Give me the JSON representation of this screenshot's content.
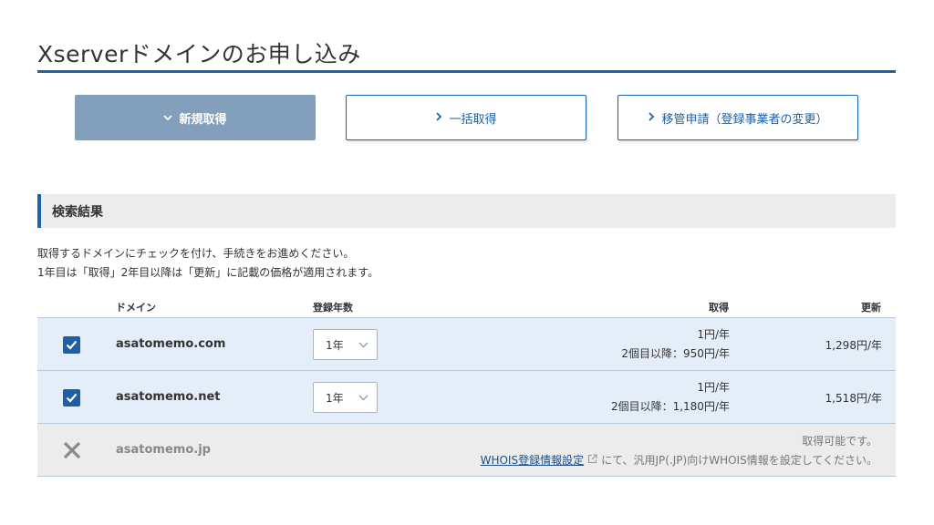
{
  "page": {
    "title": "Xserverドメインのお申し込み"
  },
  "tabs": [
    {
      "label": "新規取得",
      "chevron": "⌄",
      "active": true
    },
    {
      "label": "一括取得",
      "chevron": "›",
      "active": false
    },
    {
      "label": "移管申請（登録事業者の変更）",
      "chevron": "›",
      "active": false
    }
  ],
  "results": {
    "heading": "検索結果",
    "description_line1": "取得するドメインにチェックを付け、手続きをお進めください。",
    "description_line2": "1年目は「取得」2年目以降は「更新」に記載の価格が適用されます。"
  },
  "table": {
    "headers": {
      "domain": "ドメイン",
      "years": "登録年数",
      "acquire": "取得",
      "renew": "更新"
    },
    "rows": [
      {
        "checked": true,
        "domain": "asatomemo.com",
        "years": "1年",
        "acquire_price": "1円/年",
        "acquire_note": "2個目以降：950円/年",
        "renew_price": "1,298円/年"
      },
      {
        "checked": true,
        "domain": "asatomemo.net",
        "years": "1年",
        "acquire_price": "1円/年",
        "acquire_note": "2個目以降：1,180円/年",
        "renew_price": "1,518円/年"
      },
      {
        "checked": false,
        "domain": "asatomemo.jp",
        "status": "取得可能です。",
        "whois_link": "WHOIS登録情報設定",
        "whois_note": "にて、汎用JP(.JP)向けWHOIS情報を設定してください。"
      }
    ]
  },
  "colors": {
    "accent": "#1d62a8",
    "active_tab": "#829fbb",
    "row_selected": "#e4eef9",
    "row_disabled": "#ececec"
  }
}
